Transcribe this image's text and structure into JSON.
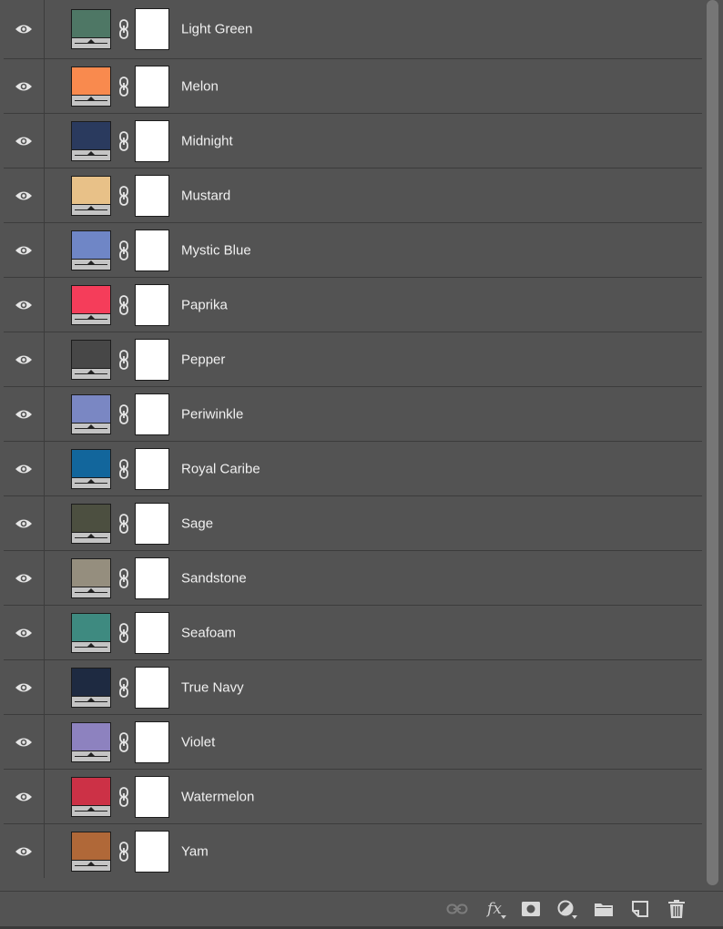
{
  "layers": [
    {
      "name": "Light Green",
      "color": "#4e7765"
    },
    {
      "name": "Melon",
      "color": "#f98a4e"
    },
    {
      "name": "Midnight",
      "color": "#2a3a5e"
    },
    {
      "name": "Mustard",
      "color": "#e8c188"
    },
    {
      "name": "Mystic Blue",
      "color": "#6f86c6"
    },
    {
      "name": "Paprika",
      "color": "#f53d5a"
    },
    {
      "name": "Pepper",
      "color": "#474747"
    },
    {
      "name": "Periwinkle",
      "color": "#7a87c3"
    },
    {
      "name": "Royal Caribe",
      "color": "#12669c"
    },
    {
      "name": "Sage",
      "color": "#4c4f40"
    },
    {
      "name": "Sandstone",
      "color": "#958e7e"
    },
    {
      "name": "Seafoam",
      "color": "#3e8a80"
    },
    {
      "name": "True Navy",
      "color": "#1e2a41"
    },
    {
      "name": "Violet",
      "color": "#8d82bf"
    },
    {
      "name": "Watermelon",
      "color": "#cc3146"
    },
    {
      "name": "Yam",
      "color": "#b06838"
    }
  ],
  "footer": {
    "fx_label": "fx",
    "icons": [
      "link-layers-icon",
      "fx-icon",
      "add-mask-icon",
      "adjustment-layer-icon",
      "group-folder-icon",
      "new-layer-icon",
      "trash-icon"
    ]
  }
}
